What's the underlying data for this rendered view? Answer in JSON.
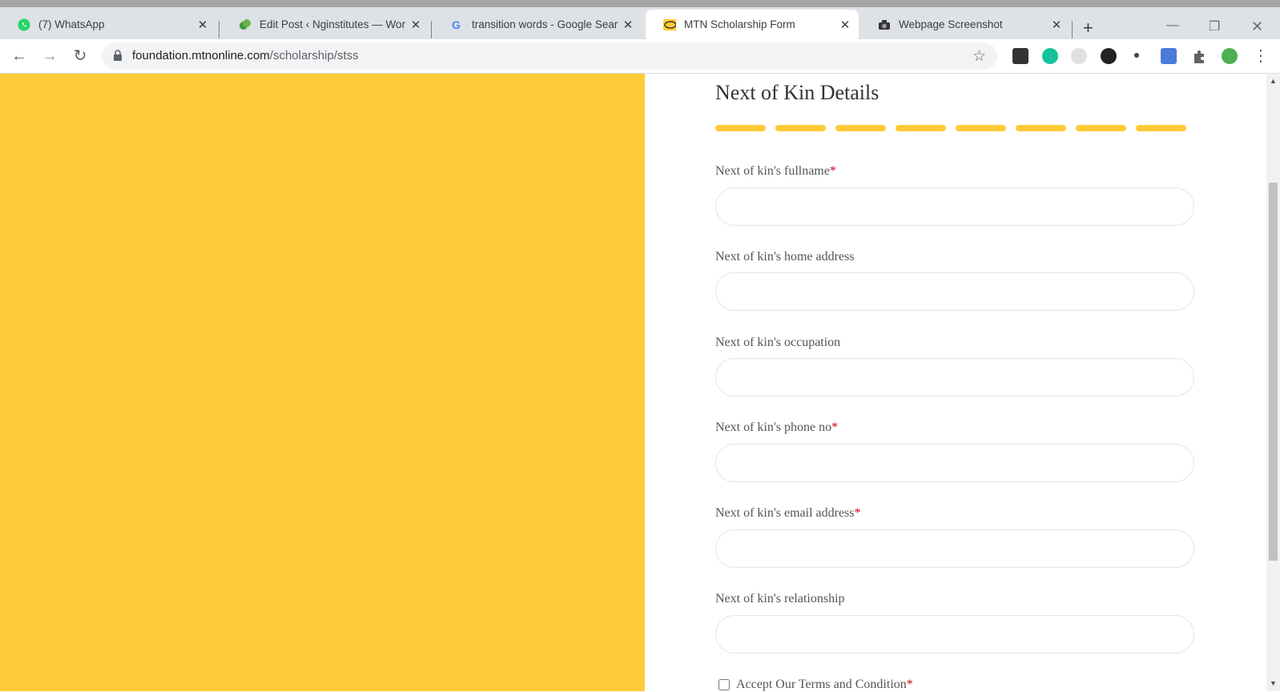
{
  "browser": {
    "tabs": [
      {
        "title": "(7) WhatsApp",
        "icon": "whatsapp-icon"
      },
      {
        "title": "Edit Post ‹ Nginstitutes — Wor",
        "icon": "site-icon"
      },
      {
        "title": "transition words - Google Sear",
        "icon": "google-icon"
      },
      {
        "title": "MTN Scholarship Form",
        "icon": "mtn-icon",
        "active": true
      },
      {
        "title": "Webpage Screenshot",
        "icon": "screenshot-extension-icon"
      }
    ],
    "url_domain": "foundation.mtnonline.com",
    "url_path": "/scholarship/stss"
  },
  "form": {
    "section_title": "Next of Kin Details",
    "progress_segments": 8,
    "required_marker": "*",
    "fields": [
      {
        "label": "Next of kin's fullname",
        "required": true,
        "value": ""
      },
      {
        "label": "Next of kin's home address",
        "required": false,
        "value": ""
      },
      {
        "label": "Next of kin's occupation",
        "required": false,
        "value": ""
      },
      {
        "label": "Next of kin's phone no",
        "required": true,
        "value": ""
      },
      {
        "label": "Next of kin's email address",
        "required": true,
        "value": ""
      },
      {
        "label": "Next of kin's relationship",
        "required": false,
        "value": ""
      }
    ],
    "terms_label": "Accept Our Terms and Condition",
    "terms_required": true,
    "terms_checked": false
  },
  "colors": {
    "brand_yellow": "#ffca38",
    "required_red": "#d0021b"
  }
}
